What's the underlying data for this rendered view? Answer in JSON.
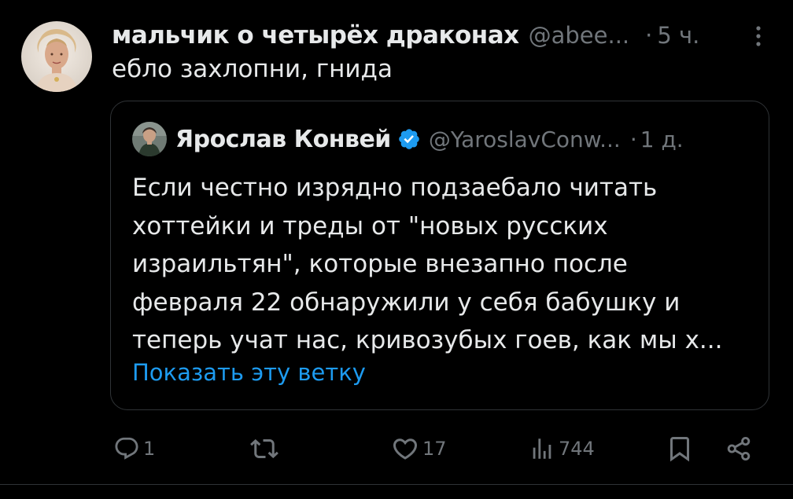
{
  "tweet": {
    "author_name": "мальчик о четырёх драконах",
    "author_handle": "@abee...",
    "time": "5 ч.",
    "text": "ебло захлопни, гнида"
  },
  "quoted_tweet": {
    "author_name": "Ярослав Конвей",
    "author_handle": "@YaroslavConw...",
    "time": "1 д.",
    "verified": true,
    "text_lines": [
      "Если честно изрядно подзаебало читать",
      "хоттейки и треды от \"новых русских",
      "израильтян\", которые внезапно после",
      "февраля 22 обнаружили у себя бабушку и",
      "теперь учат нас, кривозубых гоев, как мы х..."
    ],
    "show_thread_label": "Показать эту ветку"
  },
  "actions": {
    "replies": "1",
    "retweets": "",
    "likes": "17",
    "views": "744"
  },
  "colors": {
    "background": "#000000",
    "text_primary": "#e7e9ea",
    "text_secondary": "#71767b",
    "accent": "#1d9bf0",
    "border": "#2f3336"
  },
  "icons": [
    "more-icon",
    "verified-badge-icon",
    "reply-icon",
    "retweet-icon",
    "like-icon",
    "views-icon",
    "bookmark-icon",
    "share-icon"
  ]
}
